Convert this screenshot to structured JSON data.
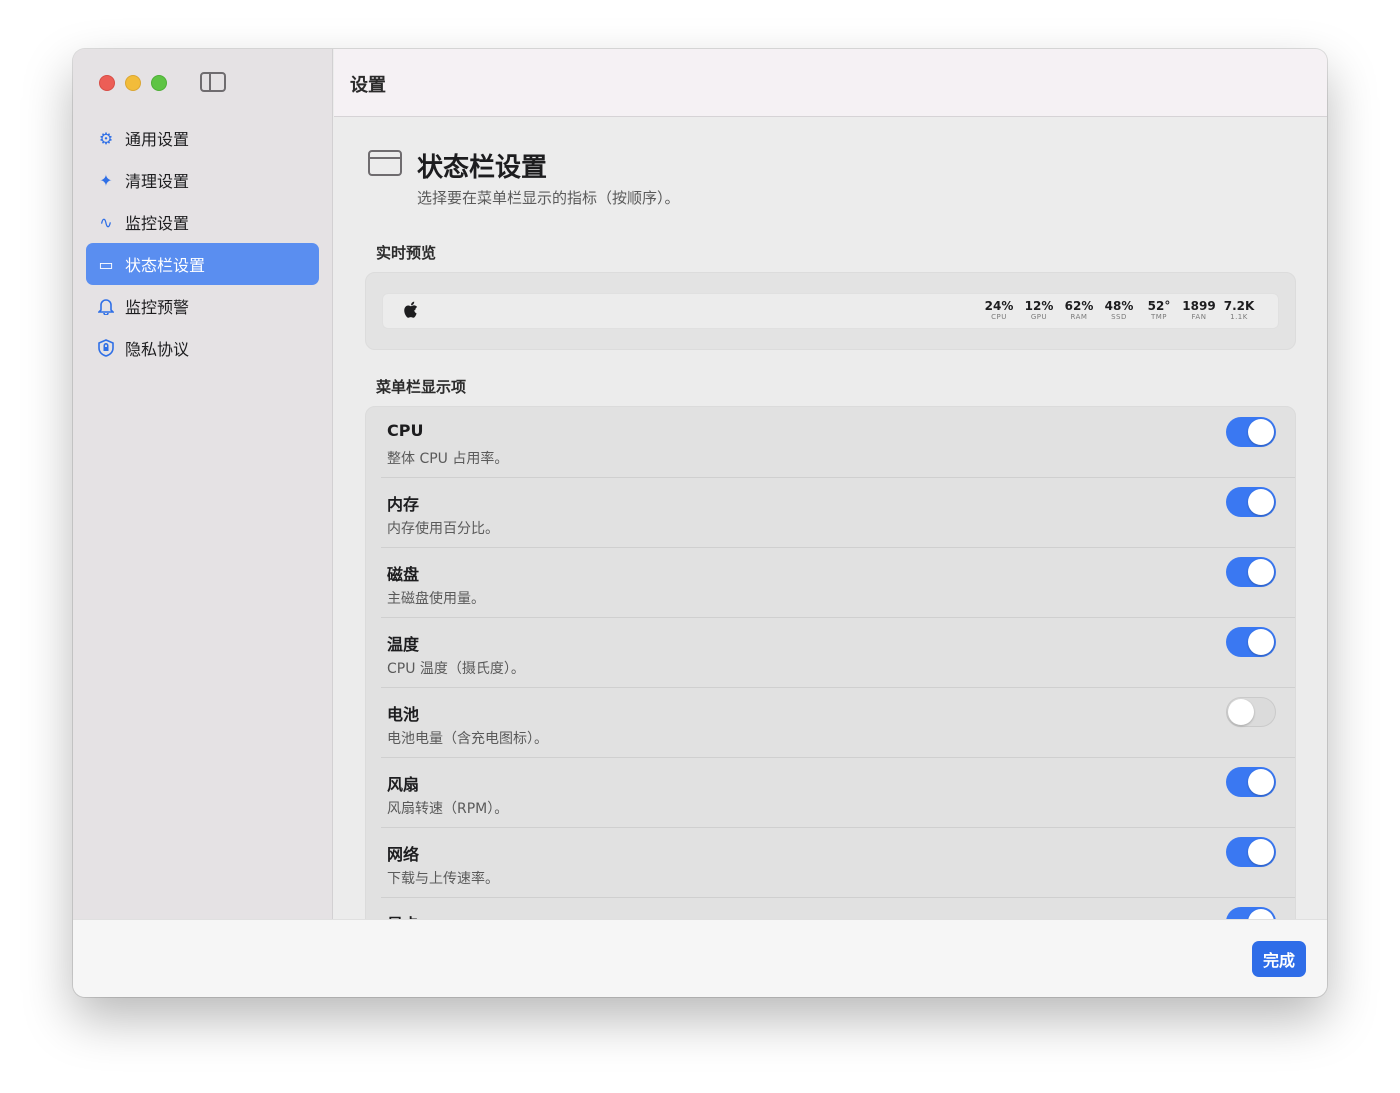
{
  "sidebar": {
    "items": [
      {
        "label": "通用设置",
        "icon": "gear-icon",
        "glyph": "⚙"
      },
      {
        "label": "清理设置",
        "icon": "sparkle-icon",
        "glyph": "✦"
      },
      {
        "label": "监控设置",
        "icon": "pulse-icon",
        "glyph": "∿"
      },
      {
        "label": "状态栏设置",
        "icon": "menubar-icon",
        "glyph": "▭"
      },
      {
        "label": "监控预警",
        "icon": "bell-icon",
        "glyph": "♫"
      },
      {
        "label": "隐私协议",
        "icon": "shield-icon",
        "glyph": "⛉"
      }
    ]
  },
  "header": {
    "title": "设置"
  },
  "page": {
    "title": "状态栏设置",
    "subtitle": "选择要在菜单栏显示的指标（按顺序）。"
  },
  "preview": {
    "label": "实时预览",
    "apple": "",
    "metrics": [
      {
        "value": "24%",
        "label": "CPU"
      },
      {
        "value": "12%",
        "label": "GPU"
      },
      {
        "value": "62%",
        "label": "RAM"
      },
      {
        "value": "48%",
        "label": "SSD"
      },
      {
        "value": "52°",
        "label": "TMP"
      },
      {
        "value": "1899",
        "label": "FAN"
      },
      {
        "value": "7.2K",
        "label": "1.1K"
      }
    ]
  },
  "items_section": {
    "label": "菜单栏显示项",
    "rows": [
      {
        "name": "CPU",
        "desc": "整体 CPU 占用率。",
        "on": true
      },
      {
        "name": "内存",
        "desc": "内存使用百分比。",
        "on": true
      },
      {
        "name": "磁盘",
        "desc": "主磁盘使用量。",
        "on": true
      },
      {
        "name": "温度",
        "desc": "CPU 温度（摄氏度）。",
        "on": true
      },
      {
        "name": "电池",
        "desc": "电池电量（含充电图标）。",
        "on": false
      },
      {
        "name": "风扇",
        "desc": "风扇转速（RPM）。",
        "on": true
      },
      {
        "name": "网络",
        "desc": "下载与上传速率。",
        "on": true
      },
      {
        "name": "显卡",
        "desc": "",
        "on": true
      }
    ]
  },
  "footer": {
    "done_label": "完成"
  },
  "colors": {
    "accent": "#3a78f2",
    "sidebar_active": "#5a8ef0"
  }
}
